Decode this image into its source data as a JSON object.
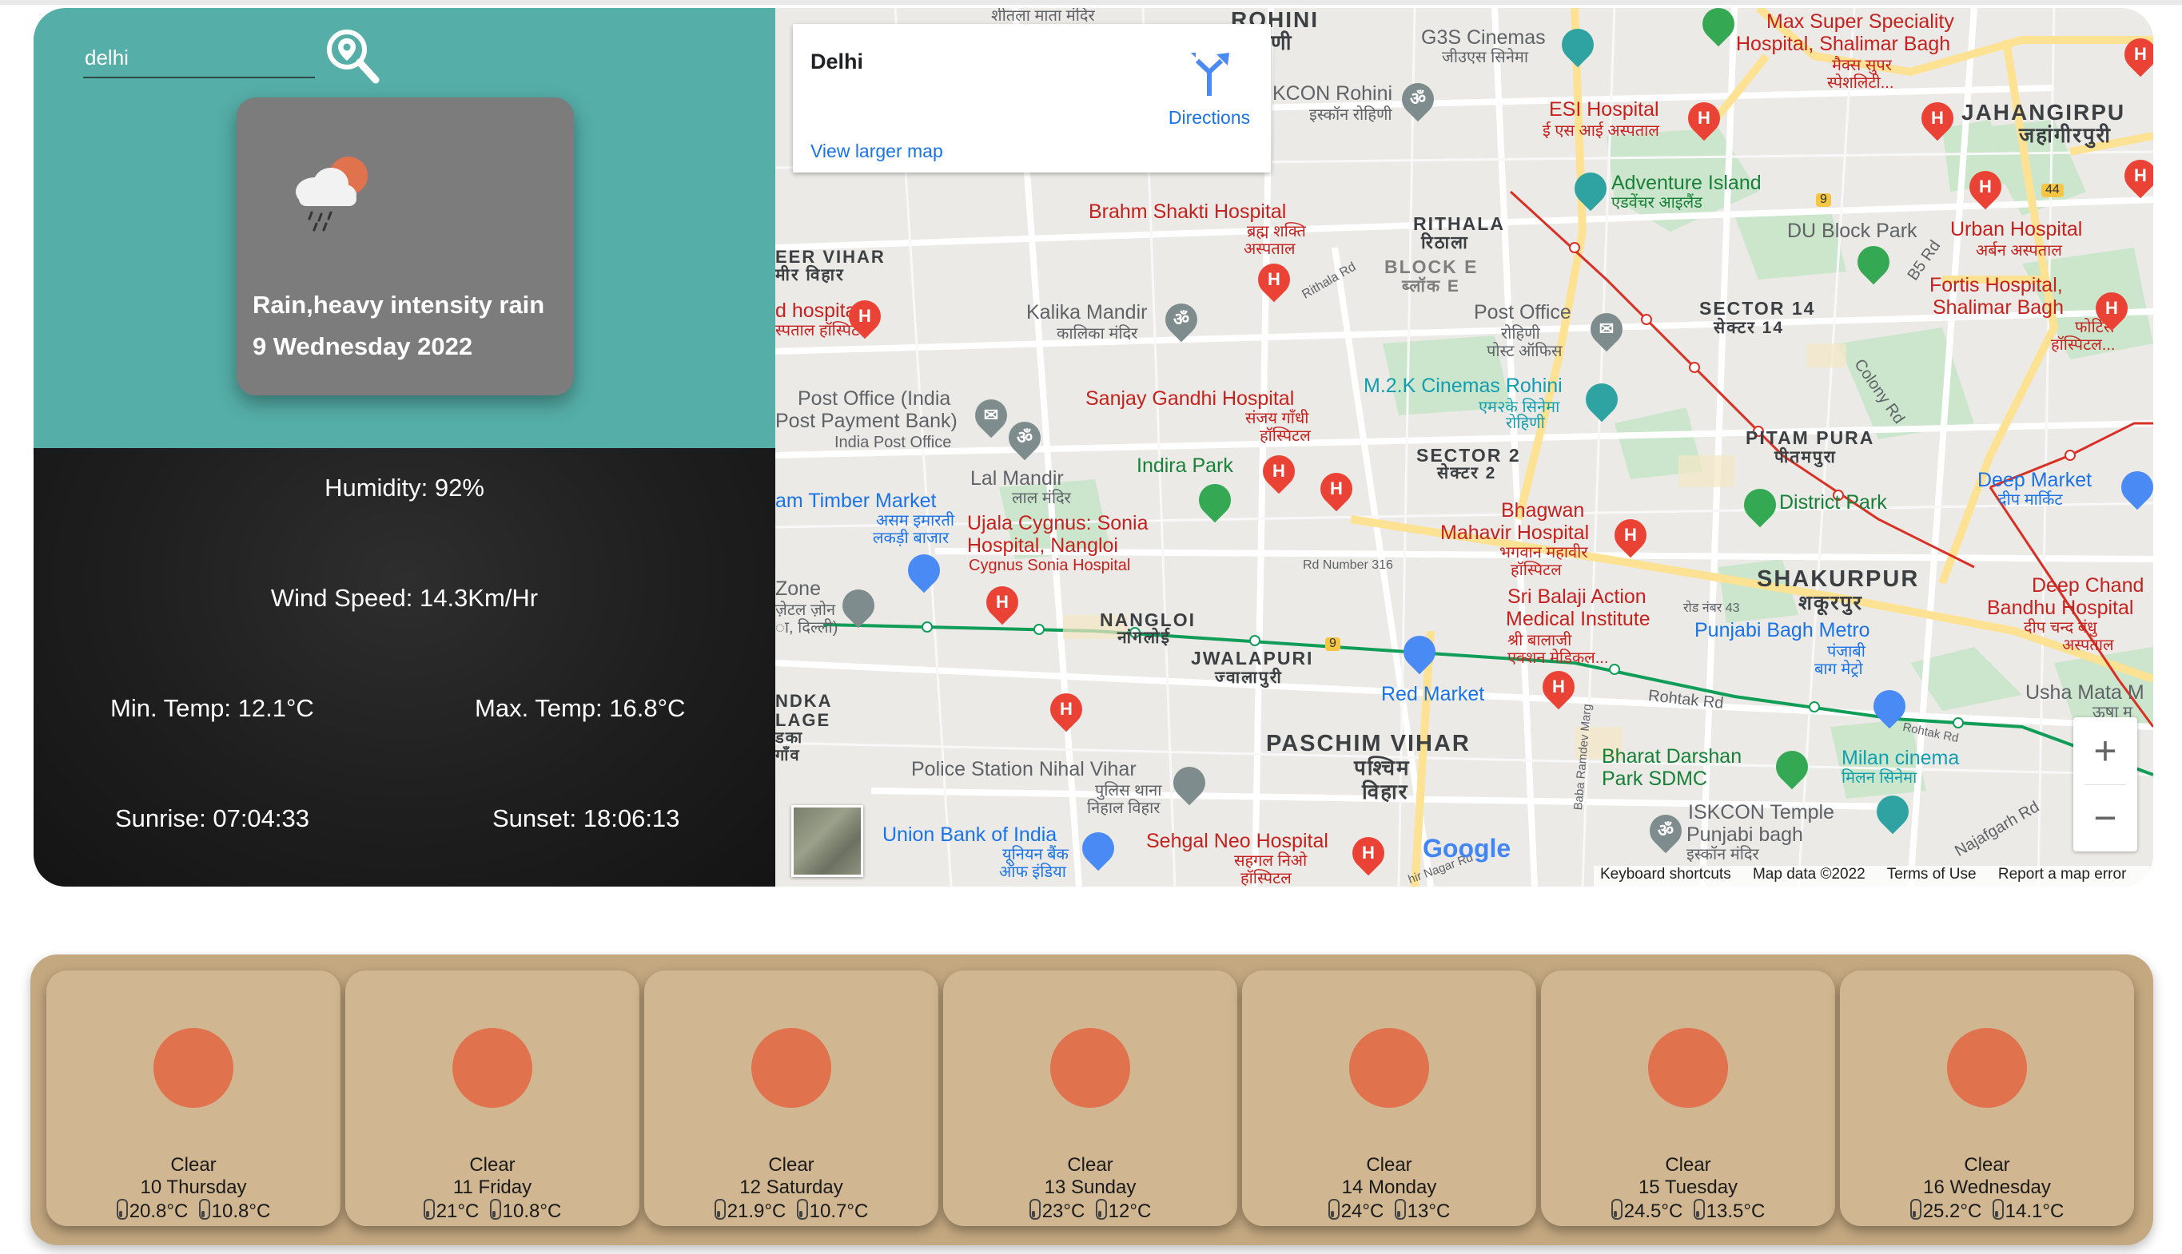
{
  "search": {
    "value": "delhi"
  },
  "current": {
    "condition": "Rain,heavy intensity rain",
    "date": "9 Wednesday 2022",
    "icon": "rain-cloud-sun-icon",
    "humidity": "Humidity: 92%",
    "wind_speed": "Wind Speed: 14.3Km/Hr",
    "min_temp": "Min. Temp: 12.1°C",
    "max_temp": "Max. Temp: 16.8°C",
    "sunrise": "Sunrise: 07:04:33",
    "sunset": "Sunset: 18:06:13"
  },
  "map": {
    "place_name": "Delhi",
    "directions_label": "Directions",
    "view_larger_label": "View larger map",
    "google_logo": "Google",
    "attribution": {
      "shortcuts": "Keyboard shortcuts",
      "map_data": "Map data ©2022",
      "terms": "Terms of Use",
      "report": "Report a map error"
    },
    "zoom_in": "+",
    "zoom_out": "−",
    "labels": {
      "rohini": "ROHINI",
      "rohini_hi": "रोहिणी",
      "g3s": "G3S Cinemas",
      "g3s_hi": "जीउएस सिनेमा",
      "max_hosp": "Max Super Speciality",
      "max_hosp2": "Hospital, Shalimar Bagh",
      "max_hosp_hi": "मैक्स सुपर",
      "max_hosp_hi2": "स्पेशलिटी...",
      "iskcon_rohini": "KCON Rohini",
      "iskcon_rohini_hi": "इस्कॉन रोहिणी",
      "esi": "ESI Hospital",
      "esi_hi": "ई एस आई अस्पताल",
      "jahangirpuri": "JAHANGIRPU",
      "jahangirpuri_hi": "जहांगीरपुरी",
      "adventure": "Adventure Island",
      "adventure_hi": "एडवेंचर आइलैंड",
      "brahm": "Brahm Shakti Hospital",
      "brahm_hi": "ब्रह्म शक्ति",
      "brahm_hi2": "अस्पताल",
      "rithala": "RITHALA",
      "rithala_hi": "रिठाला",
      "du_block": "DU Block Park",
      "urban": "Urban Hospital",
      "urban_hi": "अर्बन अस्पताल",
      "vihar": "EER VIHAR",
      "vihar_hi": "मीर विहार",
      "block_e": "BLOCK E",
      "block_e_hi": "ब्लॉक E",
      "fortis": "Fortis Hospital,",
      "fortis2": "Shalimar Bagh",
      "fortis_hi": "फोर्टिस",
      "fortis_hi2": "हॉस्पिटल...",
      "sector14": "SECTOR 14",
      "sector14_hi": "सेक्टर 14",
      "d_hospital": "d hospital",
      "d_hospital_hi": "स्पताल हॉस्पिटल",
      "kalika": "Kalika Mandir",
      "kalika_hi": "कालिका मंदिर",
      "post_office_1": "Post Office",
      "post_office_1_hi": "रोहिणी",
      "post_office_1_hi2": "पोस्ट ऑफिस",
      "mzk": "M.2.K Cinemas Rohini",
      "mzk_hi": "एम२के सिनेमा",
      "mzk_hi2": "रोहिणी",
      "post_office_2": "Post Office (India",
      "post_office_2b": "Post Payment Bank)",
      "post_office_2c": "India Post Office",
      "sanjay": "Sanjay Gandhi Hospital",
      "sanjay_hi": "संजय गाँधी",
      "sanjay_hi2": "हॉस्पिटल",
      "pitam": "PITAM PURA",
      "pitam_hi": "पीतमपुरा",
      "indira": "Indira Park",
      "sector2": "SECTOR 2",
      "sector2_hi": "सेक्टर 2",
      "lal_mandir": "Lal Mandir",
      "lal_mandir_hi": "लाल मंदिर",
      "district_park": "District Park",
      "deep_market": "Deep Market",
      "deep_market_hi": "दीप मार्किट",
      "timber": "am Timber Market",
      "timber_hi": "असम इमारती",
      "timber_hi2": "लकड़ी बाजार",
      "ujala": "Ujala Cygnus: Sonia",
      "ujala2": "Hospital, Nangloi",
      "ujala3": "Cygnus Sonia Hospital",
      "bhagwan": "Bhagwan",
      "bhagwan2": "Mahavir Hospital",
      "bhagwan_hi": "भगवान महावीर",
      "bhagwan_hi2": "हॉस्पिटल",
      "shakurpur": "SHAKURPUR",
      "shakurpur_hi": "शकूरपुर",
      "deep_chand": "Deep Chand",
      "deep_chand2": "Bandhu Hospital",
      "deep_chand_hi": "दीप चन्द बंधु",
      "deep_chand_hi2": "अस्पताल",
      "zone": "Zone",
      "zone_hi": "ज़ेटल ज़ोन",
      "zone_hi2": "ा, दिल्ली)",
      "rd316": "Rd Number 316",
      "sri_balaji": "Sri Balaji Action",
      "sri_balaji2": "Medical Institute",
      "sri_balaji_hi": "श्री बालाजी",
      "sri_balaji_hi2": "एक्शन मेडिकल...",
      "punjabi_metro": "Punjabi Bagh Metro",
      "punjabi_metro_hi": "पंजाबी",
      "punjabi_metro_hi2": "बाग मेट्रो",
      "nangloi": "NANGLOI",
      "nangloi_hi": "नांगलोई",
      "jwalapuri": "JWALAPURI",
      "jwalapuri_hi": "ज्वालापुरी",
      "rd43": "रोड नंबर 43",
      "red_market": "Red Market",
      "usha": "Usha Mata M",
      "usha_hi": "ऊषा म",
      "ndka": "NDKA",
      "ndka2": "LAGE",
      "ndka_hi": "डका",
      "ndka_hi2": "गाँव",
      "paschim": "PASCHIM VIHAR",
      "paschim_hi": "पश्चिम",
      "paschim_hi2": "विहार",
      "rohtak": "Rohtak Rd",
      "rohtak2": "Rohtak Rd",
      "bharat": "Bharat Darshan",
      "bharat2": "Park SDMC",
      "milan": "Milan cinema",
      "milan_hi": "मिलन सिनेमा",
      "police": "Police Station Nihal Vihar",
      "police_hi": "पुलिस थाना",
      "police_hi2": "निहाल विहार",
      "iskcon_temple": "ISKCON Temple",
      "iskcon_temple2": "Punjabi bagh",
      "iskcon_temple_hi": "इस्कॉन मंदिर",
      "union": "Union Bank of India",
      "union_hi": "यूनियन बैंक",
      "union_hi2": "ऑफ इंडिया",
      "sehgal": "Sehgal Neo Hospital",
      "sehgal_hi": "सहगल निओ",
      "sehgal_hi2": "हॉस्पिटल",
      "rithala_rd": "Rithala Rd",
      "b5_rd": "B5 Rd",
      "colony_rd": "Colony Rd",
      "baba_ramdev": "Baba Ramdev Marg",
      "najafgarh": "Najafgarh Rd",
      "nagar_rd": "hir Nagar Rd",
      "mata_mandir": "शीतला माता मंदिर",
      "badge9": "9",
      "badge9b": "9",
      "badge44": "44"
    }
  },
  "forecast": [
    {
      "condition": "Clear",
      "date": "10 Thursday",
      "max": "20.8°C",
      "min": "10.8°C",
      "icon": "sun-icon"
    },
    {
      "condition": "Clear",
      "date": "11 Friday",
      "max": "21°C",
      "min": "10.8°C",
      "icon": "sun-icon"
    },
    {
      "condition": "Clear",
      "date": "12 Saturday",
      "max": "21.9°C",
      "min": "10.7°C",
      "icon": "sun-icon"
    },
    {
      "condition": "Clear",
      "date": "13 Sunday",
      "max": "23°C",
      "min": "12°C",
      "icon": "sun-icon"
    },
    {
      "condition": "Clear",
      "date": "14 Monday",
      "max": "24°C",
      "min": "13°C",
      "icon": "sun-icon"
    },
    {
      "condition": "Clear",
      "date": "15 Tuesday",
      "max": "24.5°C",
      "min": "13.5°C",
      "icon": "sun-icon"
    },
    {
      "condition": "Clear",
      "date": "16 Wednesday",
      "max": "25.2°C",
      "min": "14.1°C",
      "icon": "sun-icon"
    }
  ],
  "colors": {
    "top_panel": "#55aea8",
    "card": "#7c7c7c",
    "forecast_bg": "#c4a880",
    "forecast_card": "#d1b791",
    "sun": "#e0724e",
    "map_red": "#c5221f",
    "map_blue": "#1a73e8"
  }
}
